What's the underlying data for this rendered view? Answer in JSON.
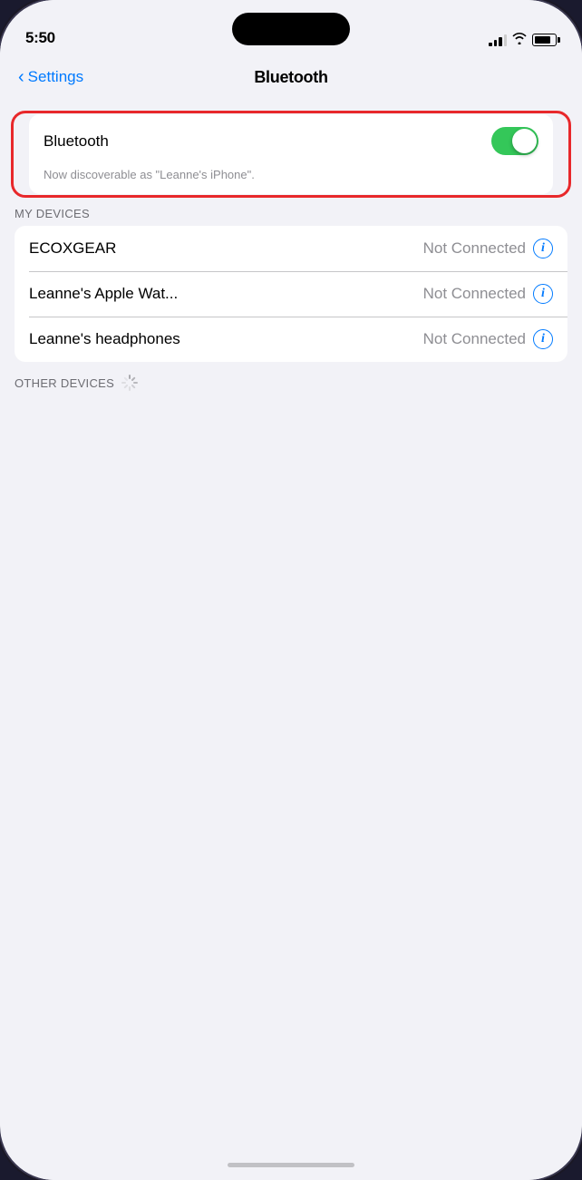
{
  "status_bar": {
    "time": "5:50"
  },
  "nav": {
    "back_label": "Settings",
    "title": "Bluetooth"
  },
  "bluetooth_section": {
    "toggle_label": "Bluetooth",
    "toggle_state": true,
    "discoverable_text": "Now discoverable as \"Leanne's iPhone\"."
  },
  "my_devices": {
    "header": "MY DEVICES",
    "devices": [
      {
        "name": "ECOXGEAR",
        "status": "Not Connected"
      },
      {
        "name": "Leanne's Apple Wat...",
        "status": "Not Connected"
      },
      {
        "name": "Leanne's headphones",
        "status": "Not Connected"
      }
    ]
  },
  "other_devices": {
    "header": "OTHER DEVICES"
  }
}
